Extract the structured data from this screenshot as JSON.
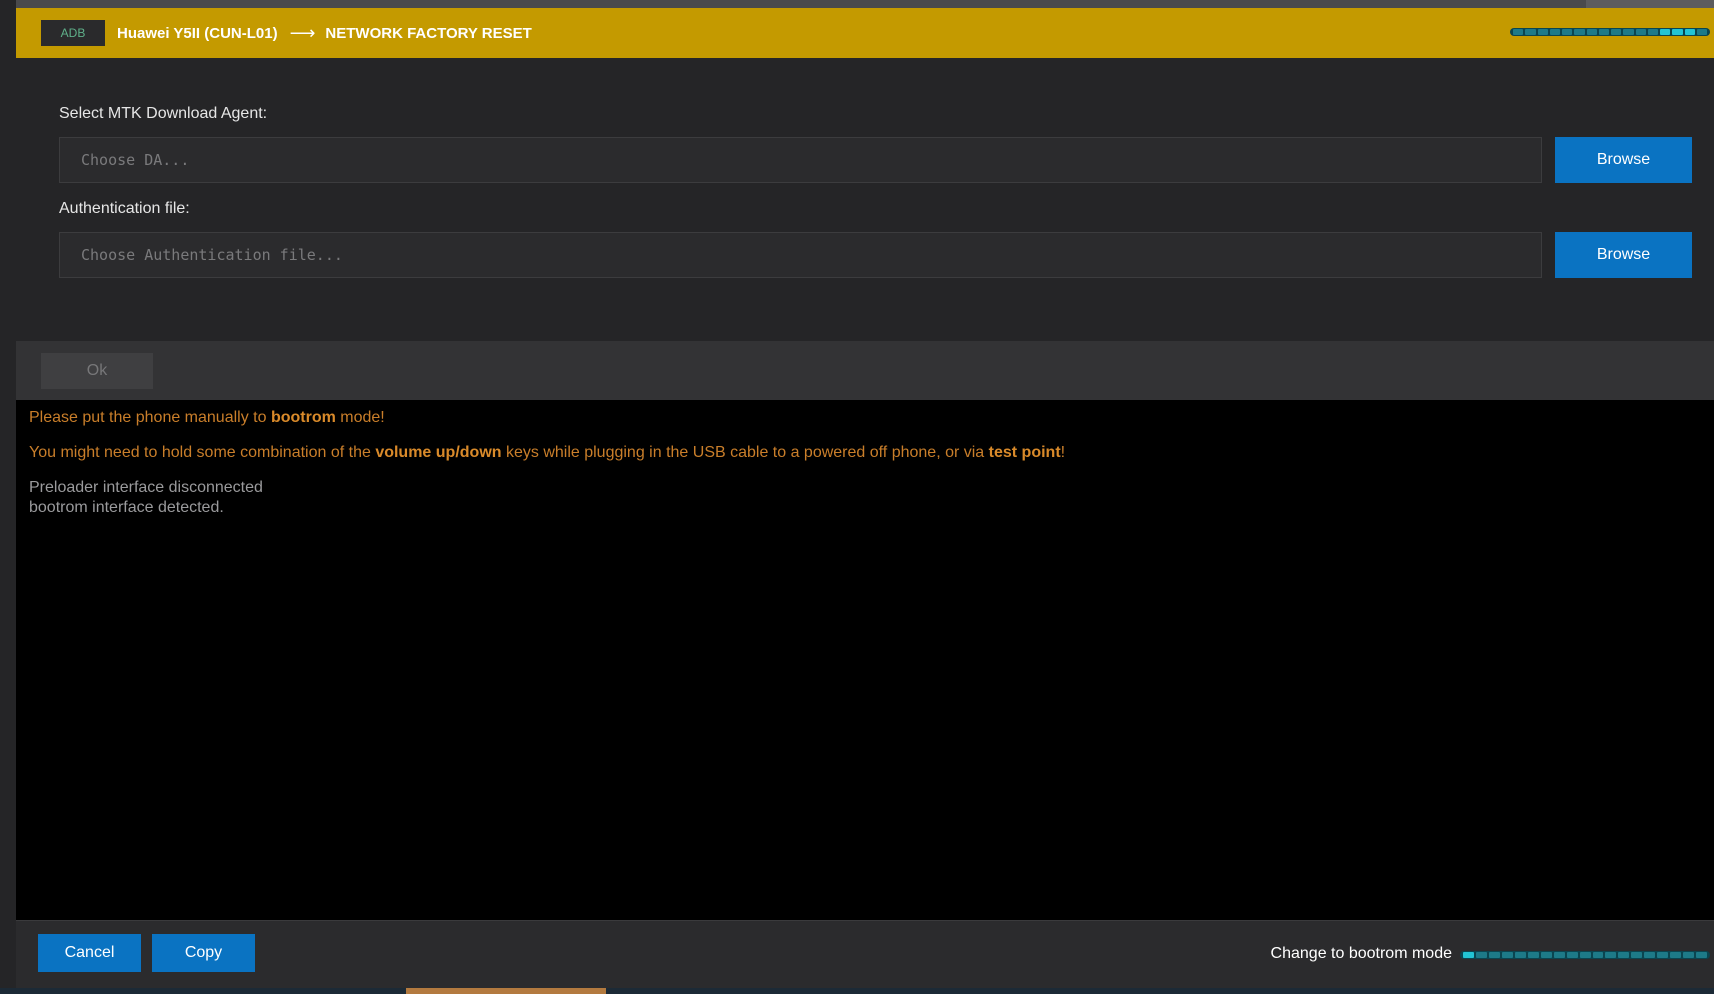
{
  "header": {
    "badge": "ADB",
    "device": "Huawei Y5II (CUN-L01)",
    "arrow": "⟶",
    "action": "NETWORK FACTORY RESET",
    "progress_accent": "#22c4d4"
  },
  "form": {
    "da_label": "Select MTK Download Agent:",
    "da_placeholder": "Choose DA...",
    "da_value": "",
    "auth_label": "Authentication file:",
    "auth_placeholder": "Choose Authentication file...",
    "auth_value": "",
    "browse_label": "Browse"
  },
  "ok_label": "Ok",
  "console": {
    "line1_pre": "Please put the phone manually to ",
    "line1_bold": "bootrom",
    "line1_post": " mode!",
    "line2_pre": "You might need to hold some combination of the ",
    "line2_bold1": "volume up/down",
    "line2_mid": " keys while plugging in the USB cable to a powered off phone, or via ",
    "line2_bold2": "test point",
    "line2_post": "!",
    "info_lines": [
      "Preloader interface disconnected",
      "bootrom interface detected."
    ]
  },
  "footer": {
    "cancel_label": "Cancel",
    "copy_label": "Copy",
    "status": "Change to bootrom mode"
  },
  "colors": {
    "header_bg": "#c49a00",
    "accent_blue": "#0a73c2",
    "warning": "#c97e2a"
  }
}
